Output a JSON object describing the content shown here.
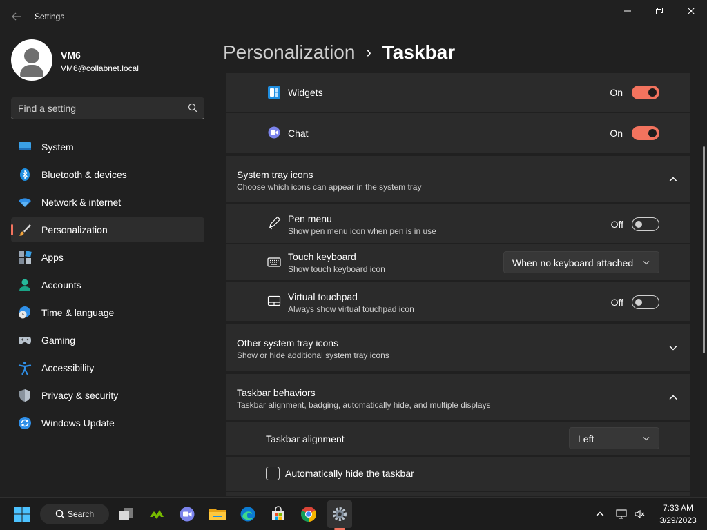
{
  "window": {
    "title": "Settings",
    "back_icon": "back-arrow-icon",
    "controls": [
      "minimize-icon",
      "restore-icon",
      "close-icon"
    ]
  },
  "profile": {
    "name": "VM6",
    "email": "VM6@collabnet.local"
  },
  "search": {
    "placeholder": "Find a setting",
    "value": ""
  },
  "sidebar": {
    "items": [
      {
        "label": "System",
        "icon": "system-icon"
      },
      {
        "label": "Bluetooth & devices",
        "icon": "bluetooth-icon"
      },
      {
        "label": "Network & internet",
        "icon": "wifi-icon"
      },
      {
        "label": "Personalization",
        "icon": "brush-icon",
        "active": true
      },
      {
        "label": "Apps",
        "icon": "apps-icon"
      },
      {
        "label": "Accounts",
        "icon": "accounts-icon"
      },
      {
        "label": "Time & language",
        "icon": "globe-clock-icon"
      },
      {
        "label": "Gaming",
        "icon": "gamepad-icon"
      },
      {
        "label": "Accessibility",
        "icon": "accessibility-icon"
      },
      {
        "label": "Privacy & security",
        "icon": "shield-icon"
      },
      {
        "label": "Windows Update",
        "icon": "update-icon"
      }
    ]
  },
  "breadcrumb": {
    "parent": "Personalization",
    "separator": "›",
    "current": "Taskbar"
  },
  "taskbar_items": {
    "widgets": {
      "label": "Widgets",
      "state": "On",
      "enabled": true
    },
    "chat": {
      "label": "Chat",
      "state": "On",
      "enabled": true
    }
  },
  "system_tray": {
    "title": "System tray icons",
    "subtitle": "Choose which icons can appear in the system tray",
    "expanded": true,
    "pen_menu": {
      "title": "Pen menu",
      "subtitle": "Show pen menu icon when pen is in use",
      "state": "Off",
      "enabled": false
    },
    "touch_keyboard": {
      "title": "Touch keyboard",
      "subtitle": "Show touch keyboard icon",
      "value": "When no keyboard attached"
    },
    "virtual_touchpad": {
      "title": "Virtual touchpad",
      "subtitle": "Always show virtual touchpad icon",
      "state": "Off",
      "enabled": false
    }
  },
  "other_tray": {
    "title": "Other system tray icons",
    "subtitle": "Show or hide additional system tray icons",
    "expanded": false
  },
  "behaviors": {
    "title": "Taskbar behaviors",
    "subtitle": "Taskbar alignment, badging, automatically hide, and multiple displays",
    "expanded": true,
    "alignment": {
      "label": "Taskbar alignment",
      "value": "Left"
    },
    "auto_hide": {
      "label": "Automatically hide the taskbar",
      "checked": false
    }
  },
  "taskbar": {
    "search_label": "Search",
    "apps": [
      "start-icon",
      "search-icon",
      "task-view-icon",
      "nvidia-icon",
      "teams-chat-icon",
      "file-explorer-icon",
      "edge-icon",
      "store-icon",
      "chrome-icon",
      "settings-icon"
    ],
    "tray": [
      "chevron-up-icon",
      "network-icon",
      "volume-muted-icon"
    ],
    "time": "7:33 AM",
    "date": "3/29/2023"
  },
  "colors": {
    "accent": "#f2735e",
    "background": "#202020",
    "card": "#2b2b2b"
  }
}
